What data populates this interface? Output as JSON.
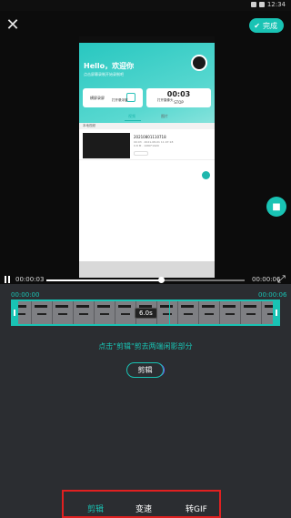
{
  "status_bar": {
    "time": "12:34"
  },
  "header": {
    "done_label": "完成"
  },
  "preview": {
    "greeting": "Hello，欢迎你",
    "subtitle": "点击屏幕录制开始录制吧",
    "screen_record_label": "横屏录屏",
    "timer": "00:03",
    "stop_label": "STOP",
    "option_1": "打开悬浮窗",
    "option_2": "打开摄像头",
    "tabs": [
      "视频",
      "图片"
    ],
    "folder_label": "本地视频",
    "item_name": "20210801110718",
    "item_meta_1": "00:03 · 2021-08-01 11:07:18",
    "item_meta_2": "0.8 M · 1080*1920",
    "item_chip": "剪辑"
  },
  "playback": {
    "current_time": "00:00:03",
    "total_time": "00:00:06",
    "progress": 0.58
  },
  "editor": {
    "start_time": "00:00:00",
    "end_time": "00:00:06",
    "duration": "6.0s",
    "hint": "点击\"剪辑\"剪去两端闲影部分",
    "trim_label": "剪辑"
  },
  "bottom_tabs": [
    {
      "label": "剪辑",
      "active": true
    },
    {
      "label": "变速",
      "active": false
    },
    {
      "label": "转GIF",
      "active": false
    }
  ],
  "colors": {
    "accent": "#19c3b4",
    "highlight_box": "#e02020"
  }
}
